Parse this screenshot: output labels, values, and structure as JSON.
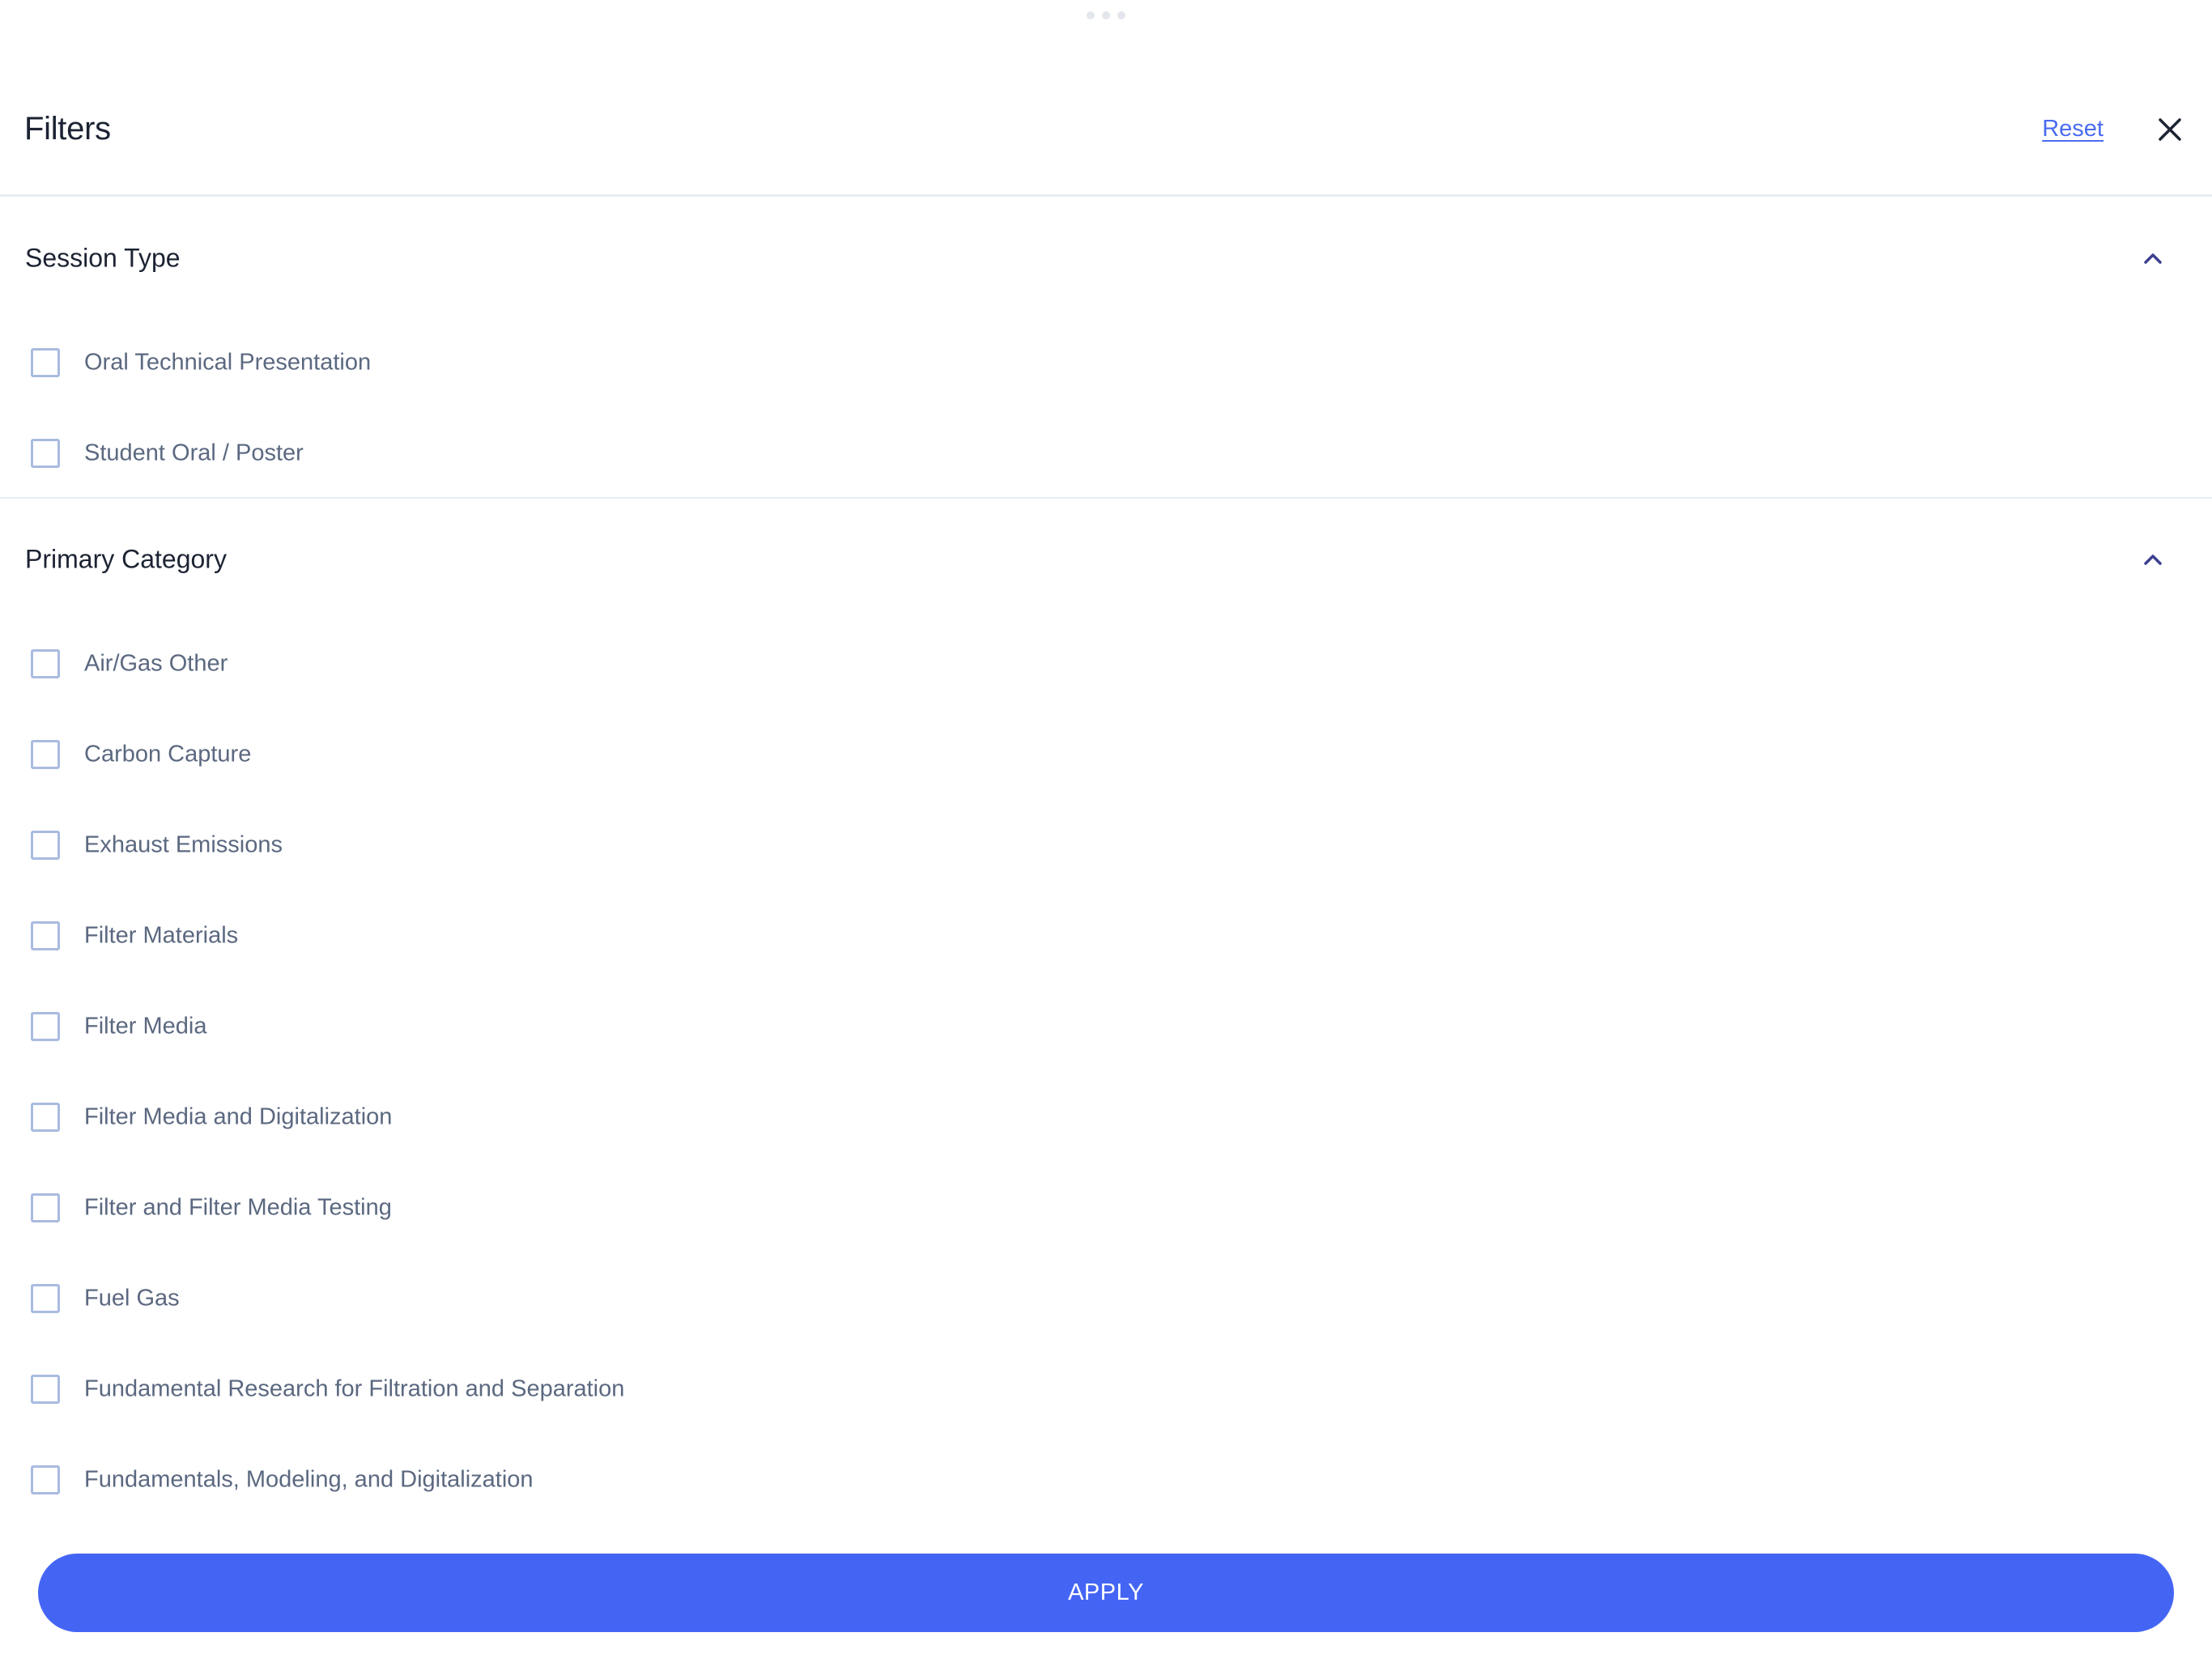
{
  "header": {
    "title": "Filters",
    "reset_label": "Reset",
    "close_icon": "close-icon"
  },
  "sections": [
    {
      "title": "Session Type",
      "expanded": true,
      "chevron_icon": "chevron-up-icon",
      "options": [
        {
          "label": "Oral Technical Presentation",
          "checked": false
        },
        {
          "label": "Student Oral / Poster",
          "checked": false
        }
      ]
    },
    {
      "title": "Primary Category",
      "expanded": true,
      "chevron_icon": "chevron-up-icon",
      "options": [
        {
          "label": "Air/Gas Other",
          "checked": false
        },
        {
          "label": "Carbon Capture",
          "checked": false
        },
        {
          "label": "Exhaust Emissions",
          "checked": false
        },
        {
          "label": "Filter Materials",
          "checked": false
        },
        {
          "label": "Filter Media",
          "checked": false
        },
        {
          "label": "Filter Media and Digitalization",
          "checked": false
        },
        {
          "label": "Filter and Filter Media Testing",
          "checked": false
        },
        {
          "label": "Fuel Gas",
          "checked": false
        },
        {
          "label": "Fundamental Research for Filtration and Separation",
          "checked": false
        },
        {
          "label": "Fundamentals, Modeling, and Digitalization",
          "checked": false
        }
      ]
    }
  ],
  "footer": {
    "apply_label": "APPLY"
  },
  "colors": {
    "accent": "#4465f4",
    "link": "#4a6cf0",
    "chevron": "#3b3f8f",
    "checkbox_border": "#a9bbe0",
    "option_text": "#5b6880",
    "heading_text": "#1c2333",
    "divider": "#e8edf4"
  }
}
